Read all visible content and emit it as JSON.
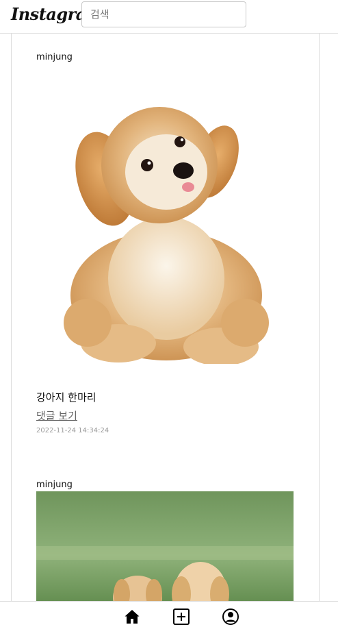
{
  "header": {
    "logo": "Instagram",
    "search_placeholder": "검색"
  },
  "posts": [
    {
      "username": "minjung",
      "image": "fluffy-puppy-photo",
      "caption": "강아지 한마리",
      "comments_link": "댓글 보기",
      "timestamp": "2022-11-24 14:34:24"
    },
    {
      "username": "minjung",
      "image": "two-puppies-on-grass-photo"
    }
  ],
  "nav": {
    "icons": [
      "home-icon",
      "add-post-icon",
      "profile-icon"
    ]
  },
  "colors": {
    "border": "#dcdcdc",
    "text": "#111111",
    "link": "#666666",
    "muted": "#9a9a9a"
  }
}
